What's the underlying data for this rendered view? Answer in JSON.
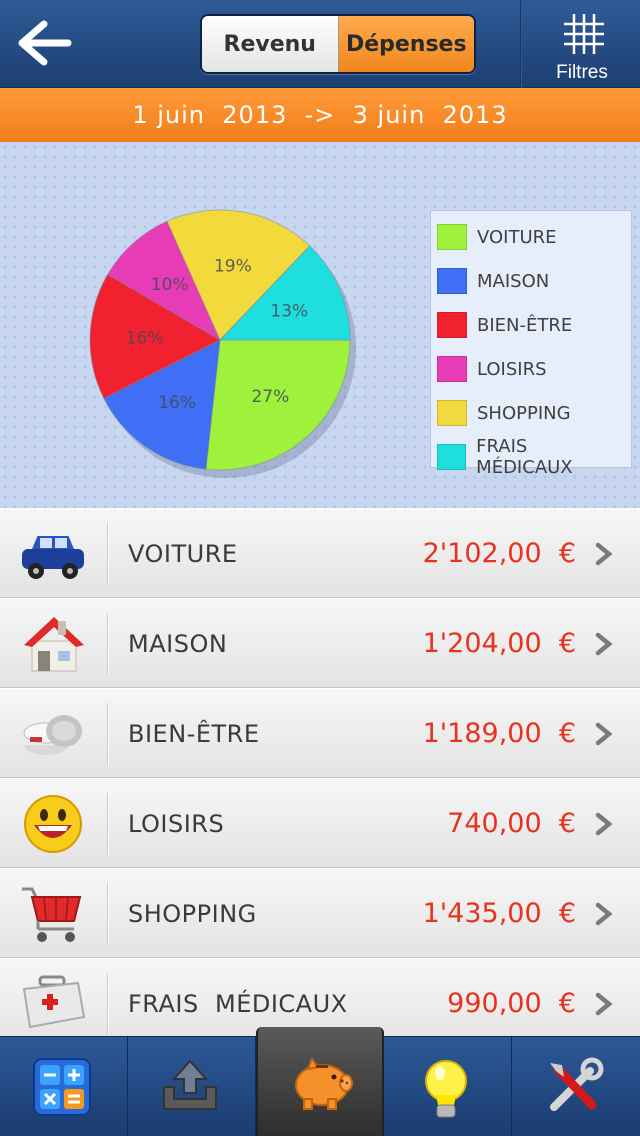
{
  "header": {
    "back_icon": "arrow-left-icon",
    "segments": [
      {
        "label": "Revenu",
        "selected": false
      },
      {
        "label": "Dépenses",
        "selected": true
      }
    ],
    "filters_label": "Filtres",
    "filters_icon": "grid-icon"
  },
  "date_range": "1 juin  2013  ->  3 juin  2013",
  "chart_data": {
    "type": "pie",
    "slices": [
      {
        "label": "VOITURE",
        "value": 27,
        "display": "27%",
        "color": "#9ef23c"
      },
      {
        "label": "MAISON",
        "value": 16,
        "display": "16%",
        "color": "#3f6ff4"
      },
      {
        "label": "BIEN-ÊTRE",
        "value": 16,
        "display": "16%",
        "color": "#f2212f"
      },
      {
        "label": "LOISIRS",
        "value": 10,
        "display": "10%",
        "color": "#e83cb6"
      },
      {
        "label": "SHOPPING",
        "value": 19,
        "display": "19%",
        "color": "#f2d93c"
      },
      {
        "label": "FRAIS MÉDICAUX",
        "value": 13,
        "display": "13%",
        "color": "#1fdede"
      }
    ],
    "legend_placement": "right"
  },
  "categories": [
    {
      "label": "VOITURE",
      "amount": "2'102,00  €",
      "icon": "car-icon"
    },
    {
      "label": "MAISON",
      "amount": "1'204,00  €",
      "icon": "house-icon"
    },
    {
      "label": "BIEN-ÊTRE",
      "amount": "1'189,00  €",
      "icon": "cream-jar-icon"
    },
    {
      "label": "LOISIRS",
      "amount": "740,00  €",
      "icon": "smiley-icon"
    },
    {
      "label": "SHOPPING",
      "amount": "1'435,00  €",
      "icon": "shopping-cart-icon"
    },
    {
      "label": "FRAIS  MÉDICAUX",
      "amount": "990,00  €",
      "icon": "first-aid-kit-icon"
    }
  ],
  "tabs": [
    {
      "name": "calculator",
      "icon": "calculator-icon",
      "active": false
    },
    {
      "name": "export",
      "icon": "upload-tray-icon",
      "active": false
    },
    {
      "name": "piggy-bank",
      "icon": "piggy-bank-icon",
      "active": true
    },
    {
      "name": "tips",
      "icon": "lightbulb-icon",
      "active": false
    },
    {
      "name": "settings",
      "icon": "tools-icon",
      "active": false
    }
  ],
  "colors": {
    "nav_blue": "#234a84",
    "orange": "#f5861f",
    "amount_red": "#e8321e"
  }
}
